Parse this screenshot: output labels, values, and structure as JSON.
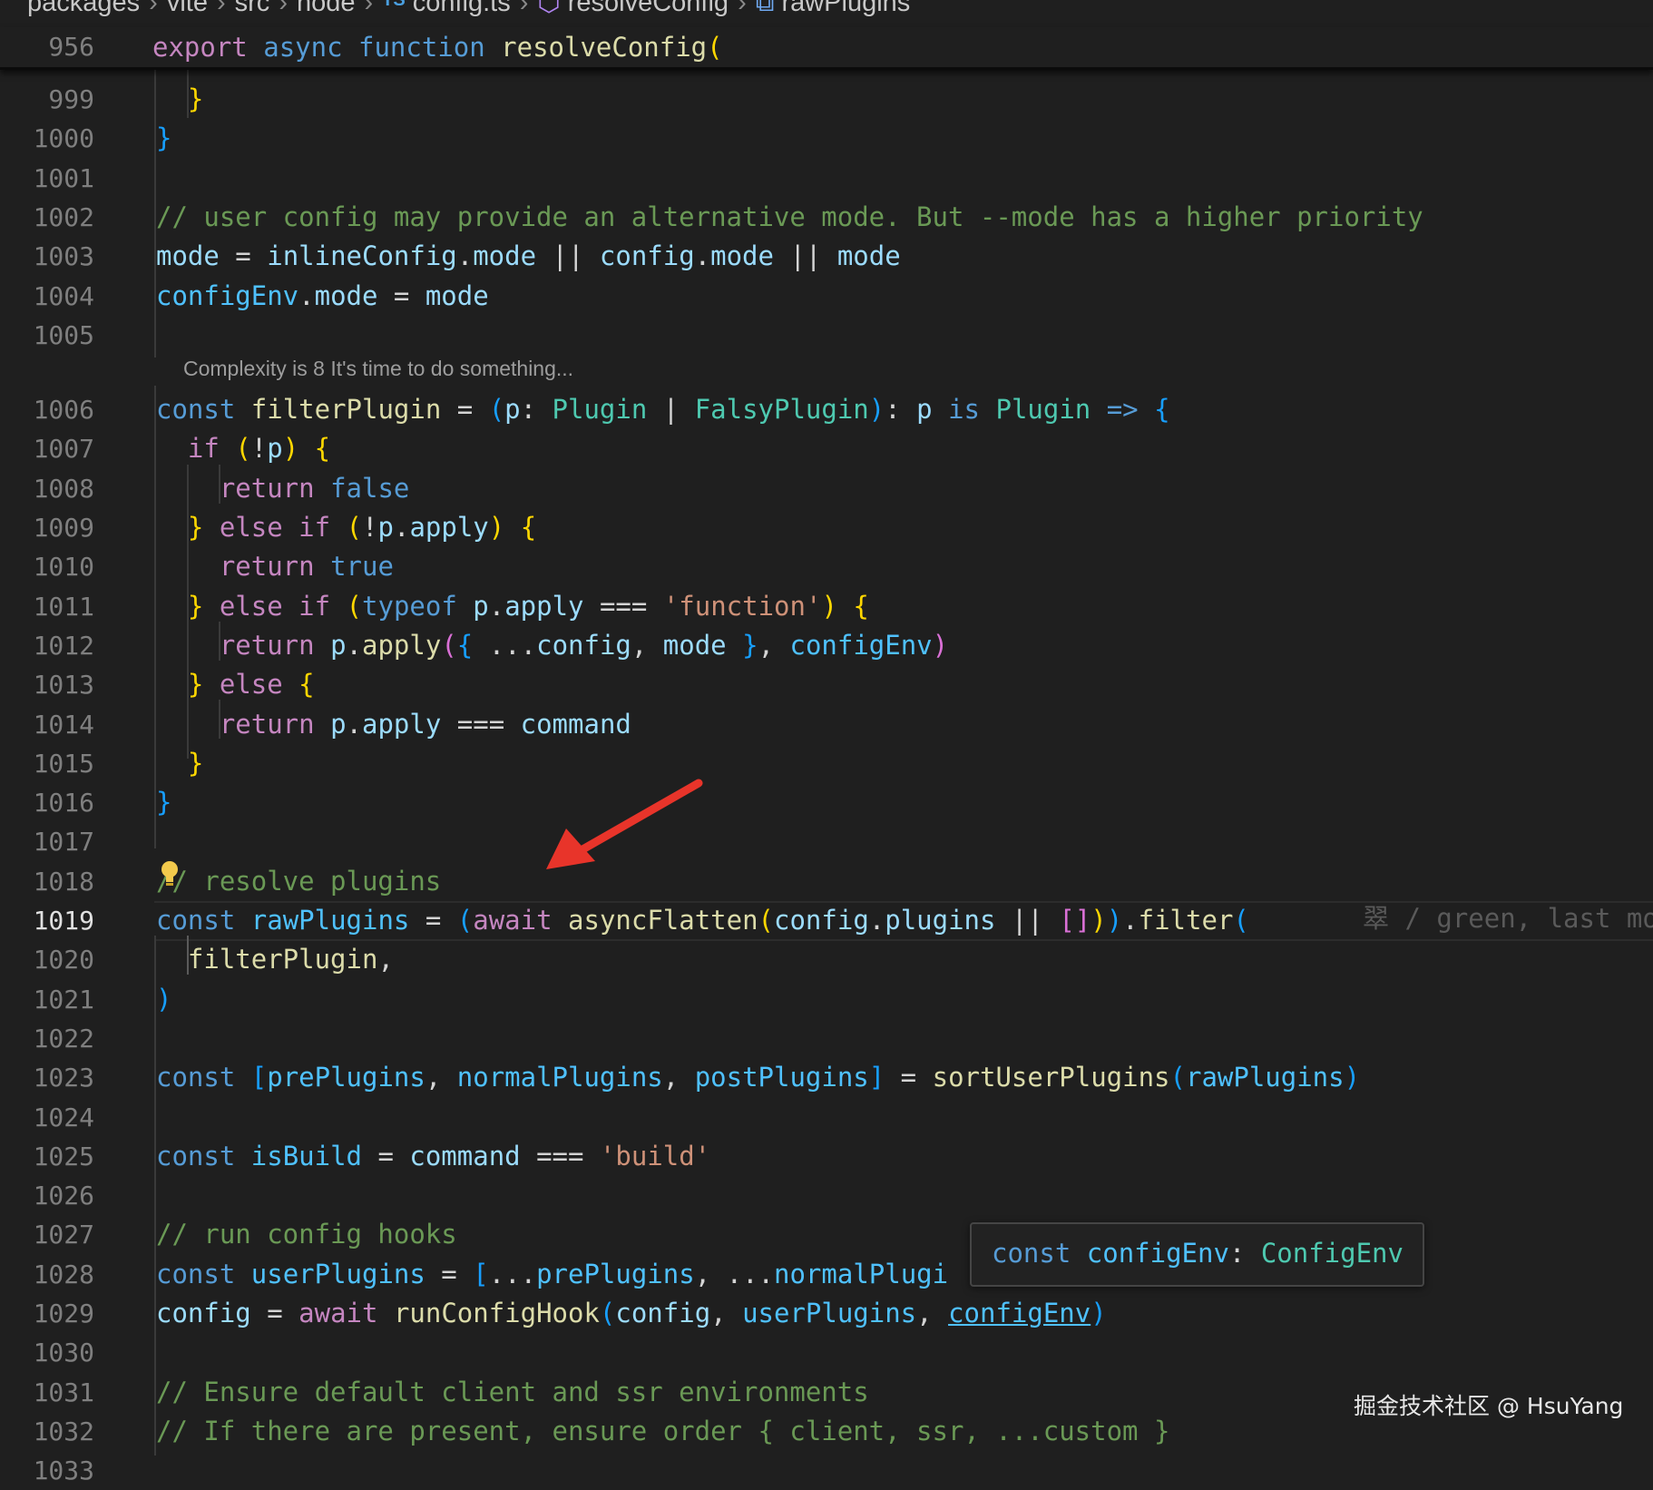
{
  "breadcrumb": {
    "items": [
      "packages",
      "vite",
      "src",
      "node",
      "config.ts",
      "resolveConfig",
      "rawPlugins"
    ],
    "file_badge": "TS"
  },
  "sticky_scroll": {
    "line_number": "956",
    "code": "export async function resolveConfig("
  },
  "codelens": "Complexity is 8 It's time to do something...",
  "git_blame": "翠 / green, last mo",
  "hover": {
    "text": "const configEnv: ConfigEnv"
  },
  "watermark": "掘金技术社区 @ HsuYang",
  "lines": [
    {
      "n": "999",
      "code": "  }"
    },
    {
      "n": "1000",
      "code": "}"
    },
    {
      "n": "1001",
      "code": ""
    },
    {
      "n": "1002",
      "code": "// user config may provide an alternative mode. But --mode has a higher priority"
    },
    {
      "n": "1003",
      "code": "mode = inlineConfig.mode || config.mode || mode"
    },
    {
      "n": "1004",
      "code": "configEnv.mode = mode"
    },
    {
      "n": "1005",
      "code": ""
    },
    {
      "n": "1006",
      "code": "const filterPlugin = (p: Plugin | FalsyPlugin): p is Plugin => {"
    },
    {
      "n": "1007",
      "code": "  if (!p) {"
    },
    {
      "n": "1008",
      "code": "    return false"
    },
    {
      "n": "1009",
      "code": "  } else if (!p.apply) {"
    },
    {
      "n": "1010",
      "code": "    return true"
    },
    {
      "n": "1011",
      "code": "  } else if (typeof p.apply === 'function') {"
    },
    {
      "n": "1012",
      "code": "    return p.apply({ ...config, mode }, configEnv)"
    },
    {
      "n": "1013",
      "code": "  } else {"
    },
    {
      "n": "1014",
      "code": "    return p.apply === command"
    },
    {
      "n": "1015",
      "code": "  }"
    },
    {
      "n": "1016",
      "code": "}"
    },
    {
      "n": "1017",
      "code": ""
    },
    {
      "n": "1018",
      "code": "// resolve plugins"
    },
    {
      "n": "1019",
      "code": "const rawPlugins = (await asyncFlatten(config.plugins || [])).filter("
    },
    {
      "n": "1020",
      "code": "  filterPlugin,"
    },
    {
      "n": "1021",
      "code": ")"
    },
    {
      "n": "1022",
      "code": ""
    },
    {
      "n": "1023",
      "code": "const [prePlugins, normalPlugins, postPlugins] = sortUserPlugins(rawPlugins)"
    },
    {
      "n": "1024",
      "code": ""
    },
    {
      "n": "1025",
      "code": "const isBuild = command === 'build'"
    },
    {
      "n": "1026",
      "code": ""
    },
    {
      "n": "1027",
      "code": "// run config hooks"
    },
    {
      "n": "1028",
      "code": "const userPlugins = [...prePlugins, ...normalPlugi"
    },
    {
      "n": "1029",
      "code": "config = await runConfigHook(config, userPlugins, configEnv)"
    },
    {
      "n": "1030",
      "code": ""
    },
    {
      "n": "1031",
      "code": "// Ensure default client and ssr environments"
    },
    {
      "n": "1032",
      "code": "// If there are present, ensure order { client, ssr, ...custom }"
    },
    {
      "n": "1033",
      "code": ""
    }
  ]
}
